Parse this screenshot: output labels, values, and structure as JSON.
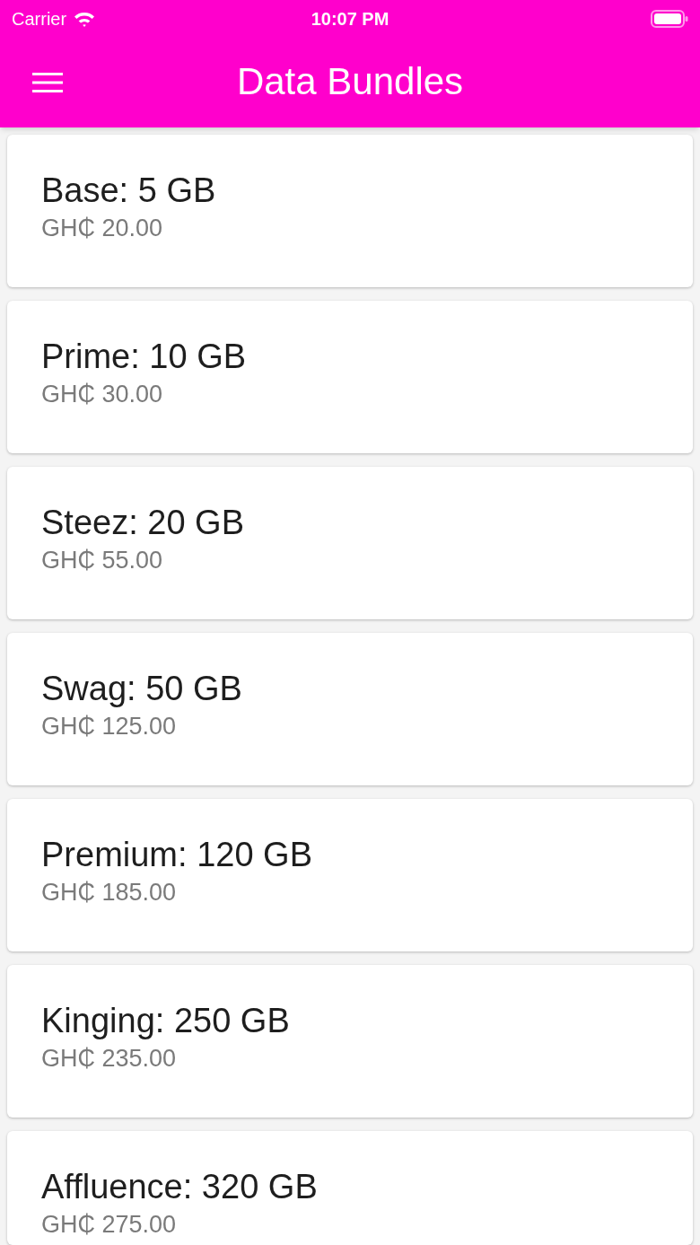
{
  "status_bar": {
    "carrier": "Carrier",
    "time": "10:07 PM"
  },
  "app_bar": {
    "title": "Data Bundles"
  },
  "bundles": [
    {
      "name": "Base: 5 GB",
      "price": "GH₵ 20.00"
    },
    {
      "name": "Prime: 10 GB",
      "price": "GH₵ 30.00"
    },
    {
      "name": "Steez: 20 GB",
      "price": "GH₵ 55.00"
    },
    {
      "name": "Swag: 50 GB",
      "price": "GH₵ 125.00"
    },
    {
      "name": "Premium: 120 GB",
      "price": "GH₵ 185.00"
    },
    {
      "name": "Kinging: 250 GB",
      "price": "GH₵ 235.00"
    },
    {
      "name": "Affluence: 320 GB",
      "price": "GH₵ 275.00"
    }
  ]
}
